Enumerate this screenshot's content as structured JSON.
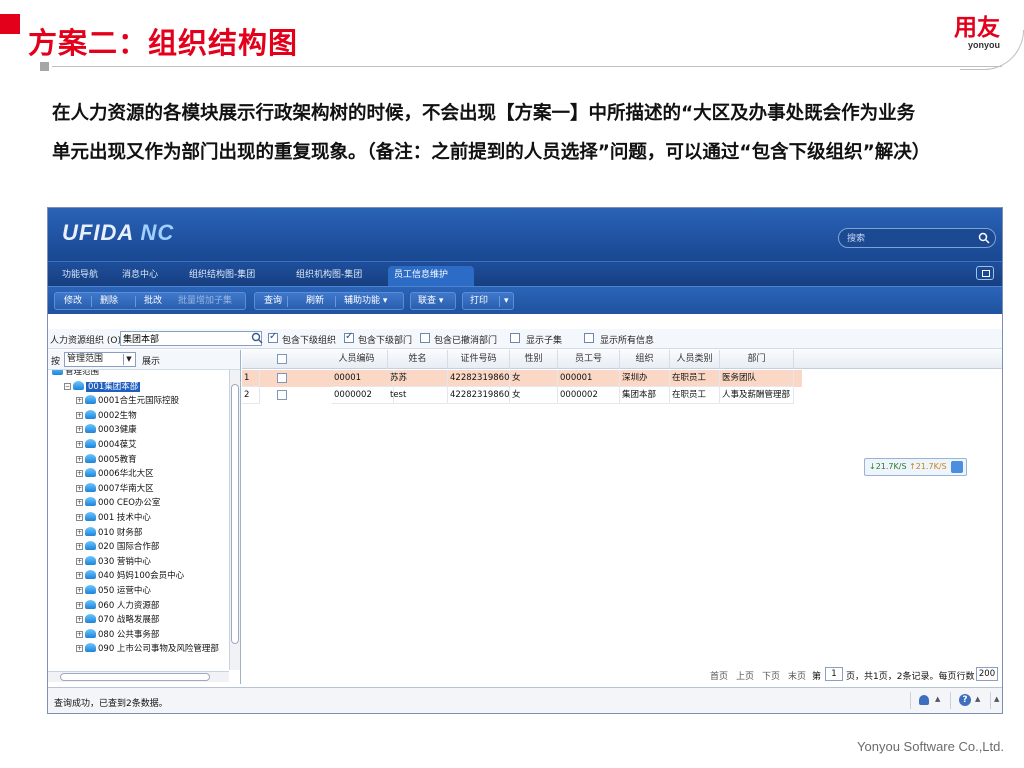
{
  "slide": {
    "title": "方案二：组织结构图",
    "logo_text": "用友",
    "logo_sub": "yonyou",
    "description": "在人力资源的各模块展示行政架构树的时候，不会出现【方案一】中所描述的“大区及办事处既会作为业务单元出现又作为部门出现的重复现象。（备注：之前提到的人员选择”问题，可以通过“包含下级组织”解决）",
    "footer": "Yonyou Software Co.,Ltd."
  },
  "app": {
    "brand": "UFIDA",
    "brand_suffix": "NC",
    "search_placeholder": "搜索",
    "nav_tabs": [
      "功能导航",
      "消息中心",
      "组织结构图-集团",
      "组织机构图-集团",
      "员工信息维护"
    ],
    "active_tab": "员工信息维护",
    "toolbar": {
      "group1": [
        "修改",
        "删除",
        "批改",
        "批量增加子集"
      ],
      "group2": [
        "查询",
        "刷新",
        "辅助功能 ▾"
      ],
      "linked": "联查 ▾",
      "print": "打印",
      "print_arrow": "▾"
    },
    "filter": {
      "org_label": "人力资源组织 (O)",
      "org_value": "集团本部",
      "include_sub_org": "包含下级组织",
      "include_sub_dept": "包含下级部门",
      "include_cancelled_dept": "包含已撤消部门",
      "show_subset": "显示子集",
      "show_all_info": "显示所有信息"
    },
    "tree": {
      "scope_label": "按",
      "scope_value": "管理范围",
      "expand_label": "展示",
      "items": [
        {
          "label": "管理范围",
          "level": 0,
          "plus": false,
          "cut": true
        },
        {
          "label": "001集团本部",
          "level": 1,
          "plus": false,
          "selected": true
        },
        {
          "label": "0001合生元国际控股",
          "level": 2,
          "plus": true
        },
        {
          "label": "0002生物",
          "level": 2,
          "plus": true
        },
        {
          "label": "0003健康",
          "level": 2,
          "plus": true
        },
        {
          "label": "0004葆艾",
          "level": 2,
          "plus": true
        },
        {
          "label": "0005教育",
          "level": 2,
          "plus": true
        },
        {
          "label": "0006华北大区",
          "level": 2,
          "plus": true
        },
        {
          "label": "0007华南大区",
          "level": 2,
          "plus": true
        },
        {
          "label": "000 CEO办公室",
          "level": 2,
          "plus": true
        },
        {
          "label": "001 技术中心",
          "level": 2,
          "plus": true
        },
        {
          "label": "010 财务部",
          "level": 2,
          "plus": true
        },
        {
          "label": "020 国际合作部",
          "level": 2,
          "plus": true
        },
        {
          "label": "030 营销中心",
          "level": 2,
          "plus": true
        },
        {
          "label": "040 妈妈100会员中心",
          "level": 2,
          "plus": true
        },
        {
          "label": "050 运营中心",
          "level": 2,
          "plus": true
        },
        {
          "label": "060 人力资源部",
          "level": 2,
          "plus": true
        },
        {
          "label": "070 战略发展部",
          "level": 2,
          "plus": true
        },
        {
          "label": "080 公共事务部",
          "level": 2,
          "plus": true
        },
        {
          "label": "090 上市公司事物及风险管理部",
          "level": 2,
          "plus": true
        }
      ]
    },
    "grid": {
      "columns": [
        "人员编码",
        "姓名",
        "证件号码",
        "性别",
        "员工号",
        "组织",
        "人员类别",
        "部门"
      ],
      "rows": [
        {
          "num": "1",
          "cells": [
            "00001",
            "苏苏",
            "42282319860...",
            "女",
            "000001",
            "深圳办",
            "在职员工",
            "医务团队"
          ],
          "highlight": true
        },
        {
          "num": "2",
          "cells": [
            "0000002",
            "test",
            "42282319860...",
            "女",
            "0000002",
            "集团本部",
            "在职员工",
            "人事及薪酬管理部"
          ],
          "highlight": false
        }
      ]
    },
    "speed": {
      "down": "↓21.7K/S",
      "up": "↑21.7K/S"
    },
    "pager": {
      "first": "首页",
      "prev": "上页",
      "next": "下页",
      "last": "末页",
      "page_prefix": "第",
      "page_value": "1",
      "page_suffix": "页，共1页，2条记录。每页行数",
      "page_size": "200"
    },
    "status": "查询成功，已查到2条数据。"
  },
  "colors": {
    "accent_red": "#e3001b",
    "nc_blue": "#1e4f9c",
    "row_highlight": "#fbd8c5"
  }
}
